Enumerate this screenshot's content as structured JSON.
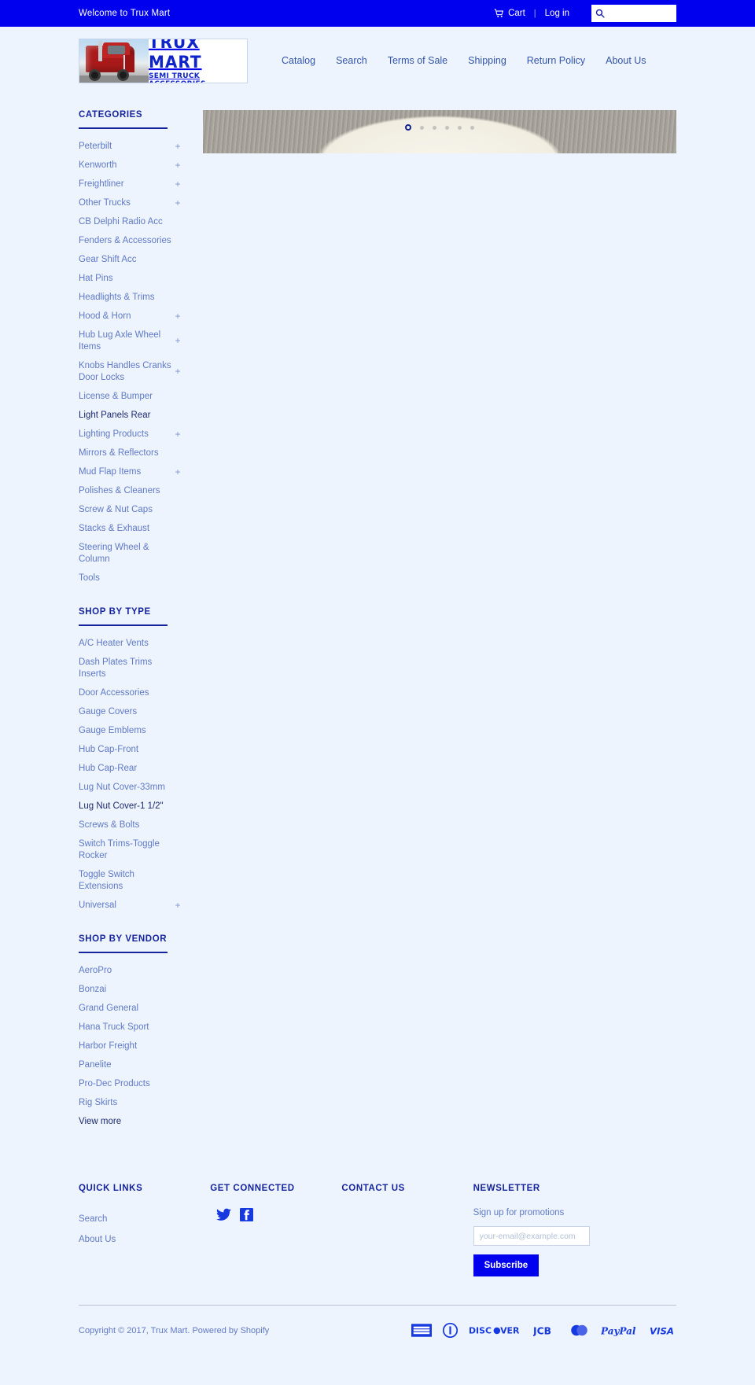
{
  "topbar": {
    "welcome": "Welcome to Trux Mart",
    "cart_label": "Cart",
    "cart_icon": "shopping-cart-icon",
    "login_label": "Log in",
    "search_icon": "search-icon",
    "search_value": "",
    "search_placeholder": ""
  },
  "brand": {
    "logo_title": "TRUX MART",
    "logo_subtitle": "SEMI TRUCK ACCESSORIES",
    "logo_image": "red-semi-truck-photo"
  },
  "nav": {
    "items": [
      {
        "label": "Catalog"
      },
      {
        "label": "Search"
      },
      {
        "label": "Terms of Sale"
      },
      {
        "label": "Shipping"
      },
      {
        "label": "Return Policy"
      },
      {
        "label": "About Us"
      }
    ]
  },
  "hero": {
    "slides_total": 6,
    "active_slide": 1
  },
  "sidebar": {
    "categories": {
      "title": "CATEGORIES",
      "items": [
        {
          "label": "Peterbilt",
          "expand": "+",
          "active": false
        },
        {
          "label": "Kenworth",
          "expand": "+",
          "active": false
        },
        {
          "label": "Freightliner",
          "expand": "+",
          "active": false
        },
        {
          "label": "Other Trucks",
          "expand": "+",
          "active": false
        },
        {
          "label": "CB Delphi Radio Acc",
          "expand": "",
          "active": false
        },
        {
          "label": "Fenders & Accessories",
          "expand": "",
          "active": false
        },
        {
          "label": "Gear Shift Acc",
          "expand": "",
          "active": false
        },
        {
          "label": "Hat Pins",
          "expand": "",
          "active": false
        },
        {
          "label": "Headlights & Trims",
          "expand": "",
          "active": false
        },
        {
          "label": "Hood & Horn",
          "expand": "+",
          "active": false
        },
        {
          "label": "Hub Lug Axle Wheel Items",
          "expand": "+",
          "active": false
        },
        {
          "label": "Knobs Handles Cranks Door Locks",
          "expand": "+",
          "active": false
        },
        {
          "label": "License & Bumper",
          "expand": "",
          "active": false
        },
        {
          "label": "Light Panels Rear",
          "expand": "",
          "active": true
        },
        {
          "label": "Lighting Products",
          "expand": "+",
          "active": false
        },
        {
          "label": "Mirrors & Reflectors",
          "expand": "",
          "active": false
        },
        {
          "label": "Mud Flap Items",
          "expand": "+",
          "active": false
        },
        {
          "label": "Polishes & Cleaners",
          "expand": "",
          "active": false
        },
        {
          "label": "Screw & Nut Caps",
          "expand": "",
          "active": false
        },
        {
          "label": "Stacks & Exhaust",
          "expand": "",
          "active": false
        },
        {
          "label": "Steering Wheel & Column",
          "expand": "",
          "active": false
        },
        {
          "label": "Tools",
          "expand": "",
          "active": false
        }
      ]
    },
    "shop_by_type": {
      "title": "SHOP BY TYPE",
      "items": [
        {
          "label": "A/C Heater Vents",
          "expand": "",
          "active": false
        },
        {
          "label": "Dash Plates Trims Inserts",
          "expand": "",
          "active": false
        },
        {
          "label": "Door Accessories",
          "expand": "",
          "active": false
        },
        {
          "label": "Gauge Covers",
          "expand": "",
          "active": false
        },
        {
          "label": "Gauge Emblems",
          "expand": "",
          "active": false
        },
        {
          "label": "Hub Cap-Front",
          "expand": "",
          "active": false
        },
        {
          "label": "Hub Cap-Rear",
          "expand": "",
          "active": false
        },
        {
          "label": "Lug Nut Cover-33mm",
          "expand": "",
          "active": false
        },
        {
          "label": "Lug Nut Cover-1 1/2\"",
          "expand": "",
          "active": true
        },
        {
          "label": "Screws & Bolts",
          "expand": "",
          "active": false
        },
        {
          "label": "Switch Trims-Toggle Rocker",
          "expand": "",
          "active": false
        },
        {
          "label": "Toggle Switch Extensions",
          "expand": "",
          "active": false
        },
        {
          "label": "Universal",
          "expand": "+",
          "active": false
        }
      ]
    },
    "shop_by_vendor": {
      "title": "SHOP BY VENDOR",
      "items": [
        {
          "label": "AeroPro",
          "expand": "",
          "active": false
        },
        {
          "label": "Bonzai",
          "expand": "",
          "active": false
        },
        {
          "label": "Grand General",
          "expand": "",
          "active": false
        },
        {
          "label": "Hana Truck Sport",
          "expand": "",
          "active": false
        },
        {
          "label": "Harbor Freight",
          "expand": "",
          "active": false
        },
        {
          "label": "Panelite",
          "expand": "",
          "active": false
        },
        {
          "label": "Pro-Dec Products",
          "expand": "",
          "active": false
        },
        {
          "label": "Rig Skirts",
          "expand": "",
          "active": false
        },
        {
          "label": "View more",
          "expand": "",
          "active": true
        }
      ]
    }
  },
  "footer": {
    "quick_links": {
      "title": "QUICK LINKS",
      "items": [
        {
          "label": "Search"
        },
        {
          "label": "About Us"
        }
      ]
    },
    "get_connected": {
      "title": "GET CONNECTED",
      "socials": [
        {
          "name": "twitter-icon"
        },
        {
          "name": "facebook-icon"
        }
      ]
    },
    "contact_us": {
      "title": "CONTACT US"
    },
    "newsletter": {
      "title": "NEWSLETTER",
      "signup_text": "Sign up for promotions",
      "email_value": "",
      "email_placeholder": "your-email@example.com",
      "subscribe_label": "Subscribe"
    },
    "copyright": "Copyright © 2017, Trux Mart. Powered by Shopify",
    "payments": [
      {
        "name": "american-express-icon",
        "label": "AMERICAN EXPRESS"
      },
      {
        "name": "diners-club-icon",
        "label": "Diners Club"
      },
      {
        "name": "discover-icon",
        "label": "DISCOVER"
      },
      {
        "name": "jcb-icon",
        "label": "JCB"
      },
      {
        "name": "mastercard-icon",
        "label": "MasterCard"
      },
      {
        "name": "paypal-icon",
        "label": "PayPal"
      },
      {
        "name": "visa-icon",
        "label": "VISA"
      }
    ]
  },
  "colors": {
    "brand_blue": "#0000ee",
    "page_bg": "#eef4fd",
    "heading_blue": "#16259e",
    "link_blue": "#5f79c6"
  }
}
